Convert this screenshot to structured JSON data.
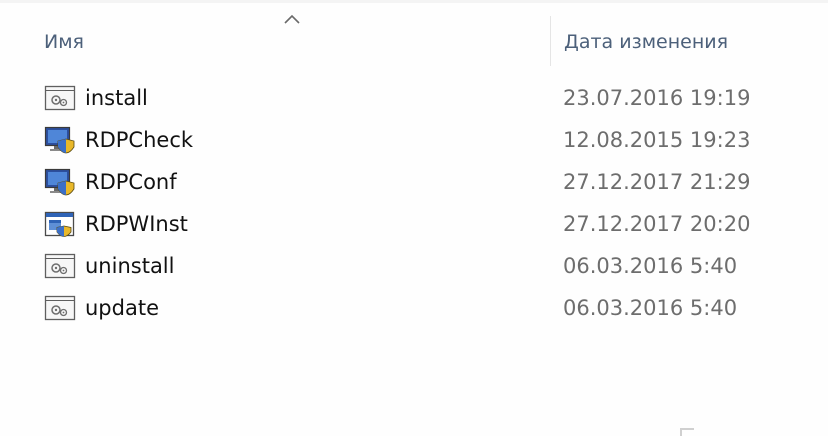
{
  "header": {
    "name_column": "Имя",
    "date_column": "Дата изменения",
    "sort_direction_icon": "sort-ascending-chevron-icon"
  },
  "files": [
    {
      "name": "install",
      "date": "23.07.2016 19:19",
      "icon": "batch-file-icon"
    },
    {
      "name": "RDPCheck",
      "date": "12.08.2015 19:23",
      "icon": "rdp-monitor-shield-icon"
    },
    {
      "name": "RDPConf",
      "date": "27.12.2017 21:29",
      "icon": "rdp-monitor-shield-icon"
    },
    {
      "name": "RDPWInst",
      "date": "27.12.2017 20:20",
      "icon": "application-window-icon"
    },
    {
      "name": "uninstall",
      "date": "06.03.2016 5:40",
      "icon": "batch-file-icon"
    },
    {
      "name": "update",
      "date": "06.03.2016 5:40",
      "icon": "batch-file-icon"
    }
  ],
  "colors": {
    "header_text": "#4c607a",
    "file_name_text": "#111111",
    "date_text": "#6d6d6d",
    "column_separator": "#e5e5e5"
  }
}
